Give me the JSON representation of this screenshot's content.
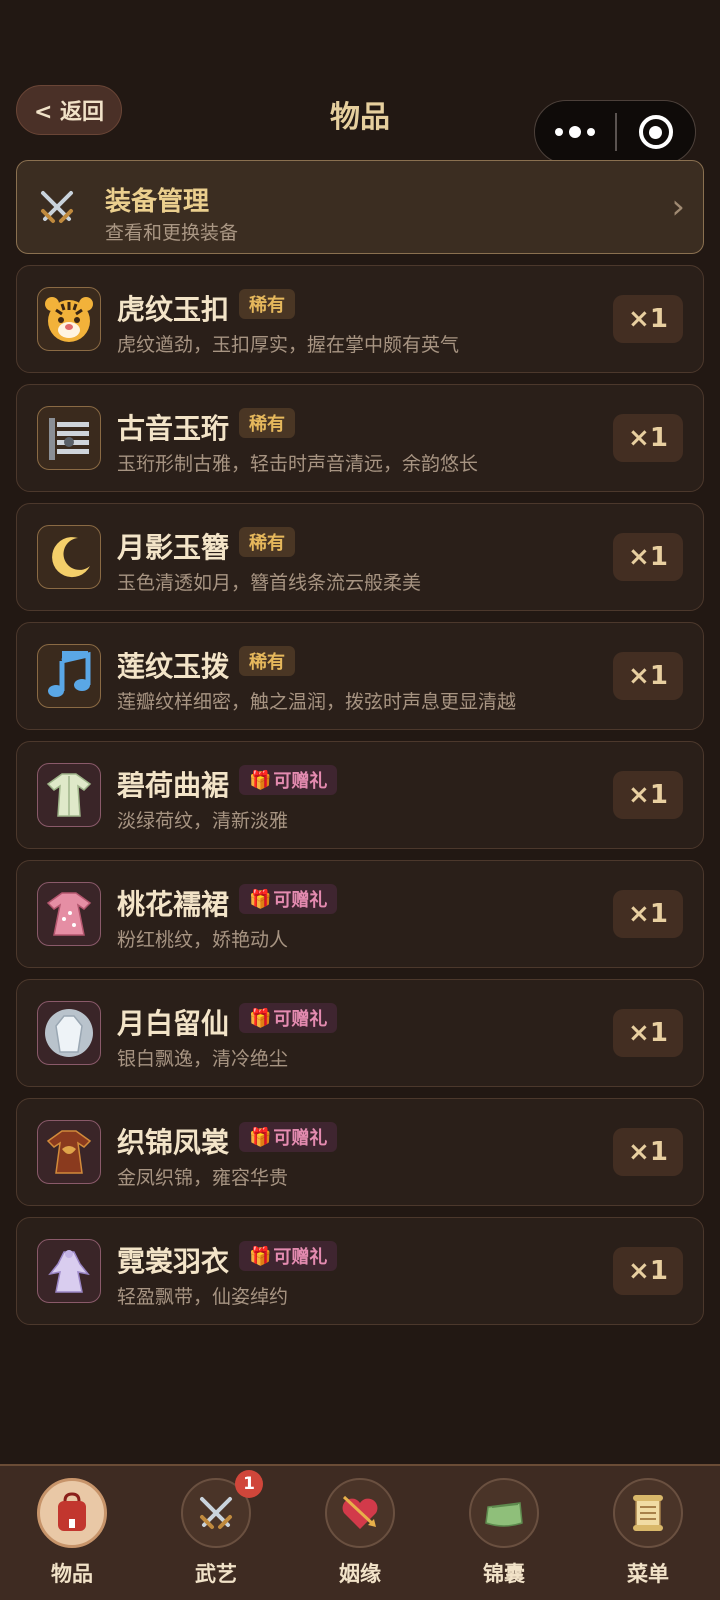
{
  "header": {
    "back_label": "< 返回",
    "title": "物品"
  },
  "equip_manage": {
    "title": "装备管理",
    "subtitle": "查看和更换装备",
    "chevron": "›"
  },
  "items": [
    {
      "name": "虎纹玉扣",
      "badge": "稀有",
      "badge_type": "rare",
      "desc": "虎纹遒劲，玉扣厚实，握在掌中颇有英气",
      "qty": "×1",
      "icon": "tiger-icon"
    },
    {
      "name": "古音玉珩",
      "badge": "稀有",
      "badge_type": "rare",
      "desc": "玉珩形制古雅，轻击时声音清远，余韵悠长",
      "qty": "×1",
      "icon": "chime-icon"
    },
    {
      "name": "月影玉簪",
      "badge": "稀有",
      "badge_type": "rare",
      "desc": "玉色清透如月，簪首线条流云般柔美",
      "qty": "×1",
      "icon": "moon-icon"
    },
    {
      "name": "莲纹玉拨",
      "badge": "稀有",
      "badge_type": "rare",
      "desc": "莲瓣纹样细密，触之温润，拨弦时声息更显清越",
      "qty": "×1",
      "icon": "music-note-icon"
    },
    {
      "name": "碧荷曲裾",
      "badge": "可赠礼",
      "badge_type": "gift",
      "desc": "淡绿荷纹，清新淡雅",
      "qty": "×1",
      "icon": "green-robe-icon"
    },
    {
      "name": "桃花襦裙",
      "badge": "可赠礼",
      "badge_type": "gift",
      "desc": "粉红桃纹，娇艳动人",
      "qty": "×1",
      "icon": "pink-dress-icon"
    },
    {
      "name": "月白留仙",
      "badge": "可赠礼",
      "badge_type": "gift",
      "desc": "银白飘逸，清冷绝尘",
      "qty": "×1",
      "icon": "white-gown-icon"
    },
    {
      "name": "织锦凤裳",
      "badge": "可赠礼",
      "badge_type": "gift",
      "desc": "金凤织锦，雍容华贵",
      "qty": "×1",
      "icon": "phoenix-robe-icon"
    },
    {
      "name": "霓裳羽衣",
      "badge": "可赠礼",
      "badge_type": "gift",
      "desc": "轻盈飘带，仙姿绰约",
      "qty": "×1",
      "icon": "feather-gown-icon"
    }
  ],
  "bottom_nav": [
    {
      "label": "物品",
      "icon": "backpack-icon",
      "active": true
    },
    {
      "label": "武艺",
      "icon": "crossed-swords-icon",
      "badge": "1"
    },
    {
      "label": "姻缘",
      "icon": "heart-arrow-icon"
    },
    {
      "label": "锦囊",
      "icon": "pouch-icon"
    },
    {
      "label": "菜单",
      "icon": "scroll-icon"
    }
  ],
  "colors": {
    "background": "#221813",
    "title_gold": "#e6cf9e",
    "rare_badge_text": "#e6b85c",
    "gift_badge_text": "#e48bb0",
    "notification_red": "#d0463a"
  }
}
